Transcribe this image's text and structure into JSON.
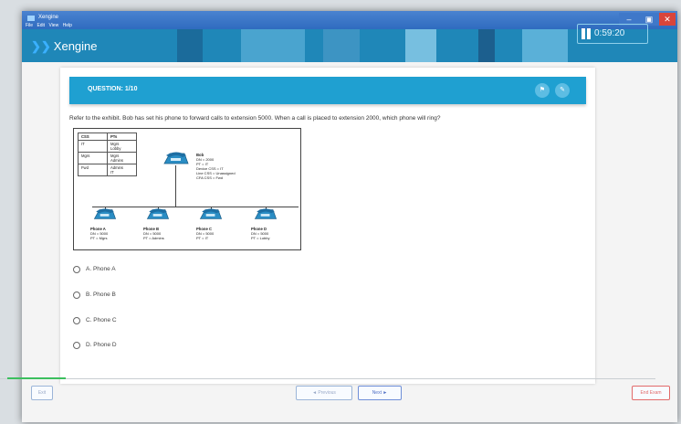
{
  "window": {
    "title": "Xengine",
    "menu": "File  Edit  View  Help",
    "controls": {
      "minimize": "–",
      "maximize": "▣",
      "close": "✕"
    }
  },
  "appbar": {
    "logo_mark": "❯❯",
    "logo_text": "Xengine",
    "timer": "0:59:20",
    "colors": {
      "bar": "#1f87b8",
      "accent": "#1fa0d1"
    }
  },
  "question": {
    "number": "QUESTION: 1/10",
    "text": "Refer to the exhibit. Bob has set his phone to forward calls to extension 5000. When a call is placed to extension 2000, which phone will ring?",
    "header_icons": [
      "flag-icon",
      "comment-icon"
    ],
    "exhibit": {
      "table": {
        "headers": [
          "CSS",
          "PTs"
        ],
        "rows": [
          [
            "IT",
            "Mgrs\nLobby"
          ],
          [
            "Mgrs",
            "Mgrs\nAdmins"
          ],
          [
            "Fwd",
            "Admins\nIT"
          ]
        ]
      },
      "bob": {
        "name": "Bob",
        "lines": [
          "DN = 2000",
          "PT = IT",
          "Device CSS = IT",
          "Line CSS = Unassigned",
          "CFA CSS = Fwd"
        ]
      },
      "phones": [
        {
          "name": "Phone A",
          "dn": "DN = 5000",
          "pt": "PT = Mgrs"
        },
        {
          "name": "Phone B",
          "dn": "DN = 5000",
          "pt": "PT = Admins"
        },
        {
          "name": "Phone C",
          "dn": "DN = 5000",
          "pt": "PT = IT"
        },
        {
          "name": "Phone D",
          "dn": "DN = 5000",
          "pt": "PT = Lobby"
        }
      ]
    },
    "options": [
      "A. Phone A",
      "B. Phone B",
      "C. Phone C",
      "D. Phone D"
    ]
  },
  "footer": {
    "left_button": "Exit",
    "prev_button": "◄ Previous",
    "next_button": "Next ►",
    "end_button": "End Exam",
    "progress": 0.1
  }
}
